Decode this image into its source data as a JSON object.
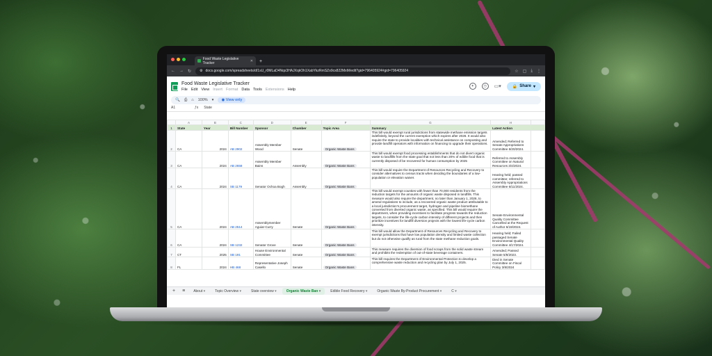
{
  "browser": {
    "tab_title": "Food Waste Legislative Tracker",
    "url": "docs.google.com/spreadsheets/d/1sU_r0MLaD4Nqx3HAJXqkOh1XabYkzRmSZo9cs822MxM/edit?gid=796405924#gid=796405924"
  },
  "doc": {
    "title": "Food Waste Legislative Tracker",
    "menus": [
      "File",
      "Edit",
      "View",
      "Insert",
      "Format",
      "Data",
      "Tools",
      "Extensions",
      "Help"
    ],
    "share_label": "Share"
  },
  "toolbar": {
    "zoom": "100%",
    "view_only": "View only"
  },
  "formula_bar": {
    "cell_ref": "A1",
    "content": "State"
  },
  "columns": [
    "A",
    "B",
    "C",
    "D",
    "E",
    "F",
    "G",
    "H"
  ],
  "headers": [
    "State",
    "Year",
    "Bill Number",
    "Sponsor",
    "Chamber",
    "Topic Area",
    "Summary",
    "Latest Action"
  ],
  "rows": [
    {
      "num": "2",
      "state": "CA",
      "year": "2024",
      "bill": "AB 2902",
      "sponsor": "Assembly Member Wood",
      "chamber": "Senate",
      "topic": "Organic Waste Bans",
      "summary": "This bill would exempt rural jurisdictions from statewide methane emission targets indefinitely, beyond the current exemption which expires after 2026. It would also require the state to provide localities with technical assistance on composting and provide landfill operators with information on financing to upgrade their operations.",
      "action": "Amended; Referred to Senate Appropriations Committee 6/20/2024."
    },
    {
      "num": "3",
      "state": "CA",
      "year": "2024",
      "bill": "AB 2658",
      "sponsor": "Assembly Member Bains",
      "chamber": "Assembly",
      "topic": "Organic Waste Bans",
      "summary": "This bill would exempt food processing establishments that do not divert organic waste to landfills from the state goal that not less than 20% of edible food that is currently disposed of be recovered for human consumption by 2025",
      "action": "Referred to Assembly Committee on Natural Resources 3/4/2024."
    },
    {
      "num": "4",
      "state": "CA",
      "year": "2024",
      "bill": "SB 1179",
      "sponsor": "Senator Ochoa Bogh",
      "chamber": "Assembly",
      "topic": "Organic Waste Bans",
      "summary": "This bill would require the Department of Resources Recycling and Recovery to consider alternatives to census tracts when deciding the boundaries of a low-population or elevation waiver.",
      "action": "Hearing held; passed committee; referred to Assembly Appropriations Committee 6/11/2024."
    },
    {
      "num": "5",
      "state": "CA",
      "year": "2024",
      "bill": "AB 2514",
      "sponsor": "Assemblymember Aguiar-Curry",
      "chamber": "Senate",
      "topic": "Organic Waste Bans",
      "summary": "This bill would exempt counties with fewer than 70,000 residents from the reduction targets for the amounts of organic waste disposed in landfills. This measure would also require the department, no later than January 1, 2026, to amend regulations to include, as a recovered organic waste product attributable to a local jurisdiction's procurement target, hydrogen and pipeline biomethane converted from diverted organic waste, as specified. This bill would require the department, when providing incentives to facilitate progress towards the reduction targets, to consider the life-cycle carbon intensity of different projects and then prioritize incentives for landfill diversion projects with the lowest life-cycle carbon intensity.",
      "action": "Senate Environmental Quality Committee Cancelled at the Request of Author 6/19/2024."
    },
    {
      "num": "6",
      "state": "CA",
      "year": "2024",
      "bill": "SB 1232",
      "sponsor": "Senator Grove",
      "chamber": "Senate",
      "topic": "Organic Waste Bans",
      "summary": "This bill would allow the Department of Resources Recycling and Recovery to exempt jurisdictions that have low population density and limited waste collection but do not otherwise qualify as rural from the state methane reduction goals.",
      "action": "Hearing held; Failed passaged Senate Environmental Quality Committee 4/17/2024."
    },
    {
      "num": "7",
      "state": "CT",
      "year": "2025",
      "bill": "SB 191",
      "sponsor": "House Environmental Committee",
      "chamber": "Senate",
      "topic": "Organic Waste Bans",
      "summary": "This measure requires the diversion of food scraps from the solid waste stream and prohibits the redemption of out-of-state beverage containers.",
      "action": "Amended; Passed Senate 5/8/2023."
    },
    {
      "num": "8",
      "state": "FL",
      "year": "2024",
      "bill": "HB 468",
      "sponsor": "Representative Joseph Casello",
      "chamber": "Senate",
      "topic": "Organic Waste Bans",
      "summary": "This bill requires the Department of Environmental Protection to develop a comprehensive waste reduction and recycling plan by July 1, 2025.",
      "action": "Died in Senate Committee on Fiscal Policy 3/8/2024"
    }
  ],
  "sheet_tabs": [
    "About",
    "Topic Overview",
    "State overview",
    "Organic Waste Ban",
    "Edible Food Recovery",
    "Organic Waste By-Product Procurement",
    "C"
  ],
  "active_tab": "Organic Waste Ban",
  "colors": {
    "header_fill": "#d9ead3",
    "share_fill": "#c2e7ff",
    "sheets_green": "#0f9d58"
  }
}
